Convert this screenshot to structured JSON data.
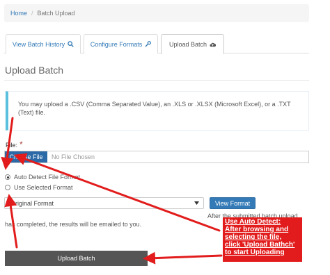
{
  "breadcrumb": {
    "home": "Home",
    "separator": "/",
    "current": "Batch Upload"
  },
  "tabs": [
    {
      "label": "View Batch History",
      "icon": "search-icon"
    },
    {
      "label": "Configure Formats",
      "icon": "wrench-icon"
    },
    {
      "label": "Upload Batch",
      "icon": "cloud-upload-icon"
    }
  ],
  "page_title": "Upload Batch",
  "info_text": "You may upload a .CSV (Comma Separated Value), an .XLS or .XLSX (Microsoft Excel), or a .TXT (Text) file.",
  "file": {
    "label": "File:",
    "required_mark": "*",
    "choose_label": "Choose File",
    "no_file": "No File Chosen"
  },
  "radios": [
    {
      "label": "Auto Detect File Format",
      "checked": true
    },
    {
      "label": "Use Selected Format",
      "checked": false
    }
  ],
  "format_select": {
    "value": "Original Format"
  },
  "view_format_label": "View Format",
  "after_text": "After the submitted batch upload",
  "completed_text": "has completed, the results will be emailed to you.",
  "upload_button": "Upload Batch",
  "callout": {
    "lines": [
      "Use Auto Detect:",
      "After browsing and",
      "selecting the file,",
      "click 'Upload Bathch'",
      "to start Uploading"
    ]
  },
  "colors": {
    "link": "#337ab7",
    "info_border": "#5bc0de",
    "annotation": "#e21c1c",
    "upload_button": "#555555"
  }
}
